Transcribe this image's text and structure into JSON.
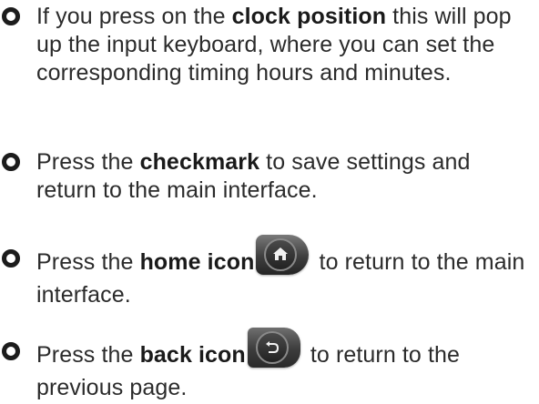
{
  "items": [
    {
      "prefix": "If you press on the ",
      "bold": "clock position",
      "suffix": " this will pop up the input keyboard, where you can set the corresponding timing hours and minutes."
    },
    {
      "prefix": "Press the ",
      "bold": "checkmark",
      "suffix": " to save settings and return to the main interface."
    },
    {
      "prefix": "Press the ",
      "bold": "home icon",
      "icon": "home-icon",
      "suffix": " to return to the main interface."
    },
    {
      "prefix": "Press the ",
      "bold": "back icon",
      "icon": "back-icon",
      "suffix": " to return to the previous page."
    }
  ]
}
